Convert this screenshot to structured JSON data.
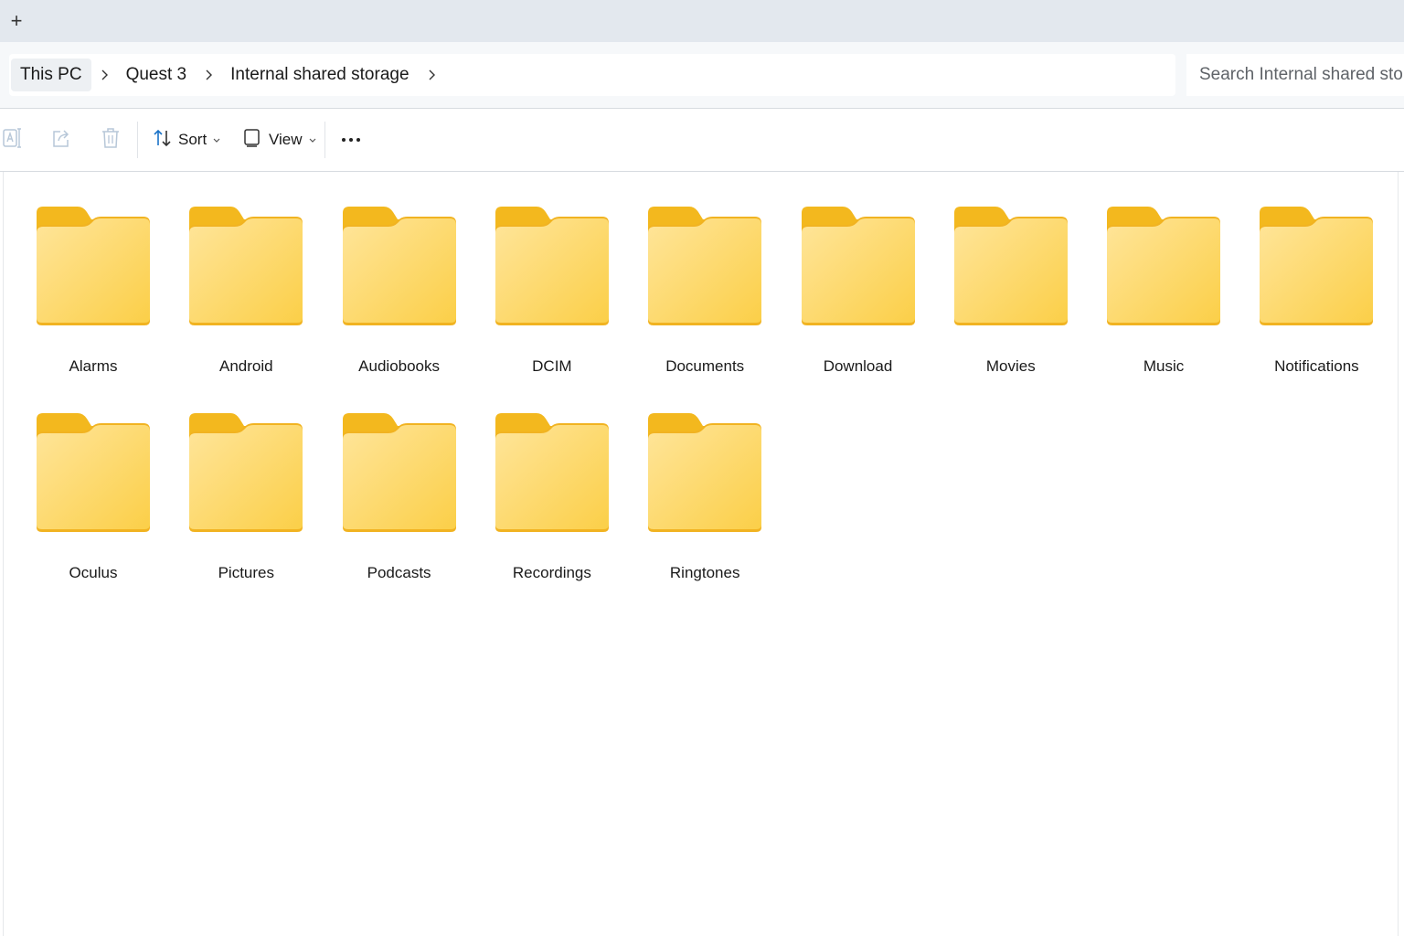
{
  "tab_bar": {
    "new_tab_symbol": "+"
  },
  "breadcrumb": {
    "items": [
      "This PC",
      "Quest 3",
      "Internal shared storage"
    ]
  },
  "search": {
    "placeholder": "Search Internal shared storage"
  },
  "toolbar": {
    "rename_icon": "rename-icon",
    "share_icon": "share-icon",
    "delete_icon": "delete-icon",
    "sort_label": "Sort",
    "view_label": "View",
    "more_icon": "more-icon"
  },
  "folders": [
    "Alarms",
    "Android",
    "Audiobooks",
    "DCIM",
    "Documents",
    "Download",
    "Movies",
    "Music",
    "Notifications",
    "Oculus",
    "Pictures",
    "Podcasts",
    "Recordings",
    "Ringtones"
  ],
  "colors": {
    "folder_back": "#f3b81e",
    "folder_front_light": "#ffe59a",
    "folder_front_dark": "#fbcf48",
    "accent": "#1a73c8"
  }
}
